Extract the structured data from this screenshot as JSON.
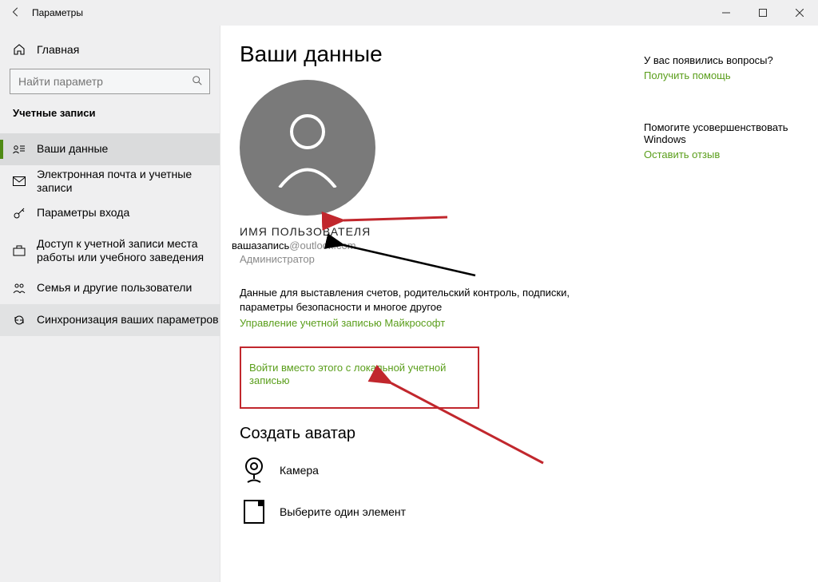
{
  "titlebar": {
    "title": "Параметры"
  },
  "sidebar": {
    "home": "Главная",
    "search_placeholder": "Найти параметр",
    "section": "Учетные записи",
    "items": [
      {
        "label": "Ваши данные"
      },
      {
        "label": "Электронная почта и учетные записи"
      },
      {
        "label": "Параметры входа"
      },
      {
        "label": "Доступ к учетной записи места работы или учебного заведения"
      },
      {
        "label": "Семья и другие пользователи"
      },
      {
        "label": "Синхронизация ваших параметров"
      }
    ]
  },
  "main": {
    "page_title": "Ваши данные",
    "username": "ИМЯ ПОЛЬЗОВАТЕЛЯ",
    "email_local": "вашазапись",
    "email_domain": "@outlook.com",
    "role": "Администратор",
    "desc": "Данные для выставления счетов, родительский контроль, подписки, параметры безопасности и многое другое",
    "manage_link": "Управление учетной записью Майкрософт",
    "local_login_link": "Войти вместо этого с локальной учетной записью",
    "create_avatar": "Создать аватар",
    "camera_label": "Камера",
    "browse_label": "Выберите один элемент"
  },
  "help": {
    "q1": "У вас появились вопросы?",
    "a1": "Получить помощь",
    "q2": "Помогите усовершенствовать Windows",
    "a2": "Оставить отзыв"
  },
  "annotation": {
    "highlight_color": "#c1272d"
  }
}
